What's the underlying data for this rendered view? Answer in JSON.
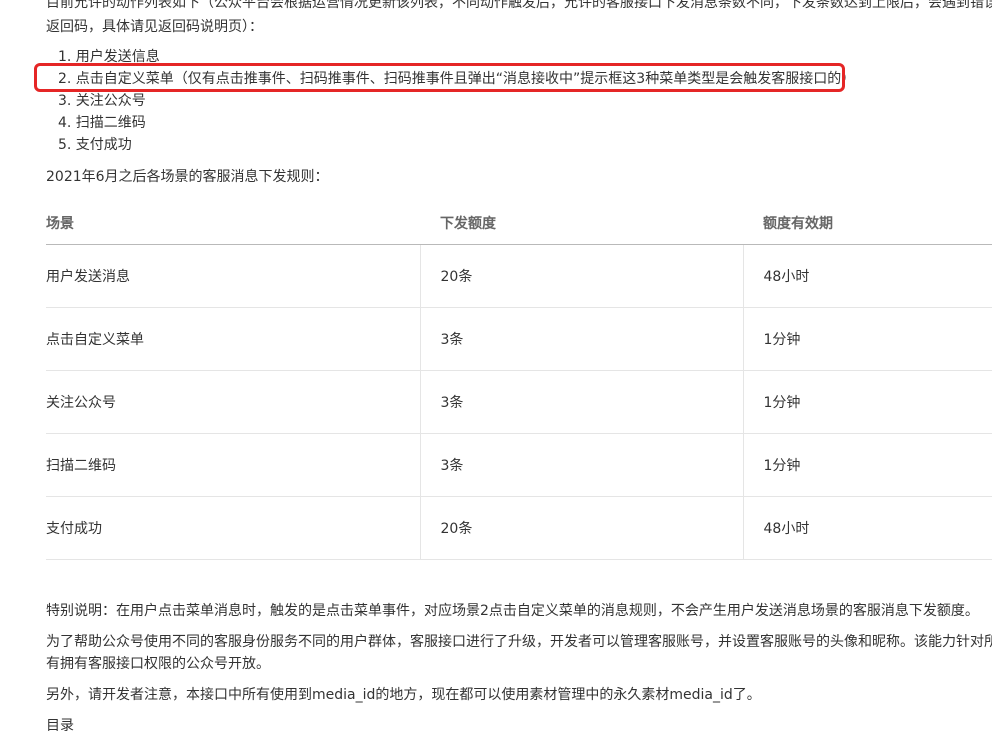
{
  "intro": {
    "line1": "目前允许的动作列表如下（公众平台会根据运营情况更新该列表，不同动作触发后，允许的客服接口下发消息条数不同，下发条数达到上限后，会遇到错误",
    "line2": "返回码，具体请见返回码说明页）："
  },
  "steps": [
    "1. 用户发送信息",
    "2. 点击自定义菜单（仅有点击推事件、扫码推事件、扫码推事件且弹出“消息接收中”提示框这3种菜单类型是会触发客服接口的）",
    "3. 关注公众号",
    "4. 扫描二维码",
    "5. 支付成功"
  ],
  "rules_title": "2021年6月之后各场景的客服消息下发规则：",
  "table": {
    "headers": [
      "场景",
      "下发额度",
      "额度有效期"
    ],
    "rows": [
      [
        "用户发送消息",
        "20条",
        "48小时"
      ],
      [
        "点击自定义菜单",
        "3条",
        "1分钟"
      ],
      [
        "关注公众号",
        "3条",
        "1分钟"
      ],
      [
        "扫描二维码",
        "3条",
        "1分钟"
      ],
      [
        "支付成功",
        "20条",
        "48小时"
      ]
    ]
  },
  "notes": {
    "special": "特别说明：在用户点击菜单消息时，触发的是点击菜单事件，对应场景2点击自定义菜单的消息规则，不会产生用户发送消息场景的客服消息下发额度。",
    "upgrade_line1": "为了帮助公众号使用不同的客服身份服务不同的用户群体，客服接口进行了升级，开发者可以管理客服账号，并设置客服账号的头像和昵称。该能力针对所",
    "upgrade_line2": "有拥有客服接口权限的公众号开放。",
    "media": "另外，请开发者注意，本接口中所有使用到media_id的地方，现在都可以使用素材管理中的永久素材media_id了。",
    "toc": "目录"
  },
  "colors": {
    "highlight": "#e52626",
    "text": "#333333",
    "header_text": "#666666"
  }
}
